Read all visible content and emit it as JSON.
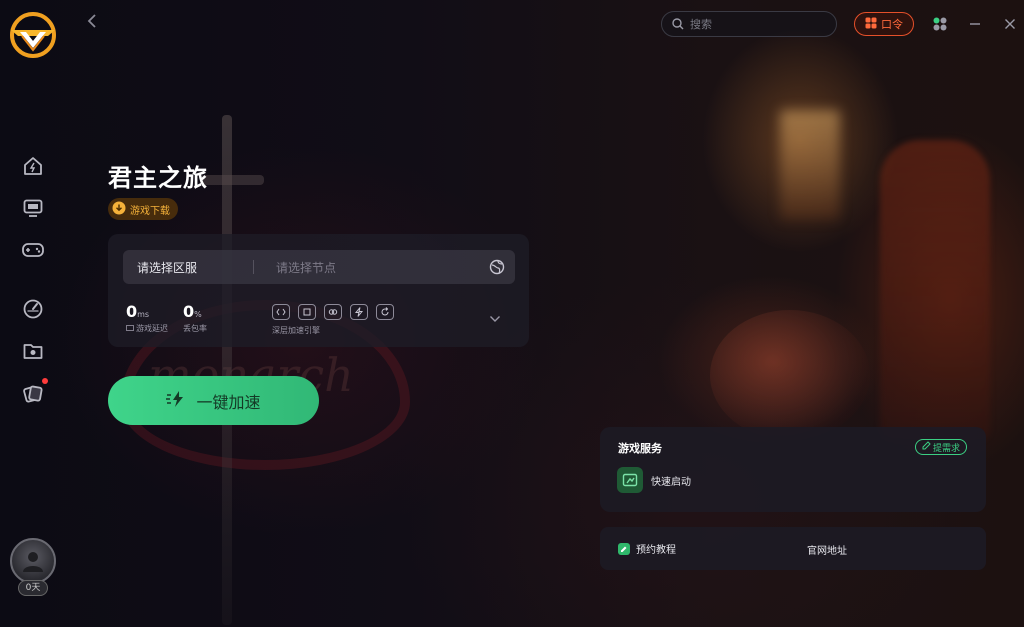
{
  "topbar": {
    "search_placeholder": "搜索",
    "kouling_label": "口令"
  },
  "game": {
    "title": "君主之旅",
    "download_label": "游戏下载"
  },
  "panel": {
    "region_placeholder": "请选择区服",
    "node_placeholder": "请选择节点",
    "latency_value": "0",
    "latency_unit": "ms",
    "latency_label": "游戏延迟",
    "loss_value": "0",
    "loss_unit": "%",
    "loss_label": "丢包率",
    "engine_label": "深层加速引擎"
  },
  "accelerate": {
    "label": "一键加速"
  },
  "service": {
    "title": "游戏服务",
    "request_label": "提需求",
    "item_label": "快速启动"
  },
  "links": {
    "tutorial": "预约教程",
    "official": "官网地址"
  },
  "user": {
    "days": "0天"
  },
  "colors": {
    "accent_green": "#3fd48a",
    "accent_orange": "#ff6a3c",
    "badge_gold": "#f5b23a"
  }
}
